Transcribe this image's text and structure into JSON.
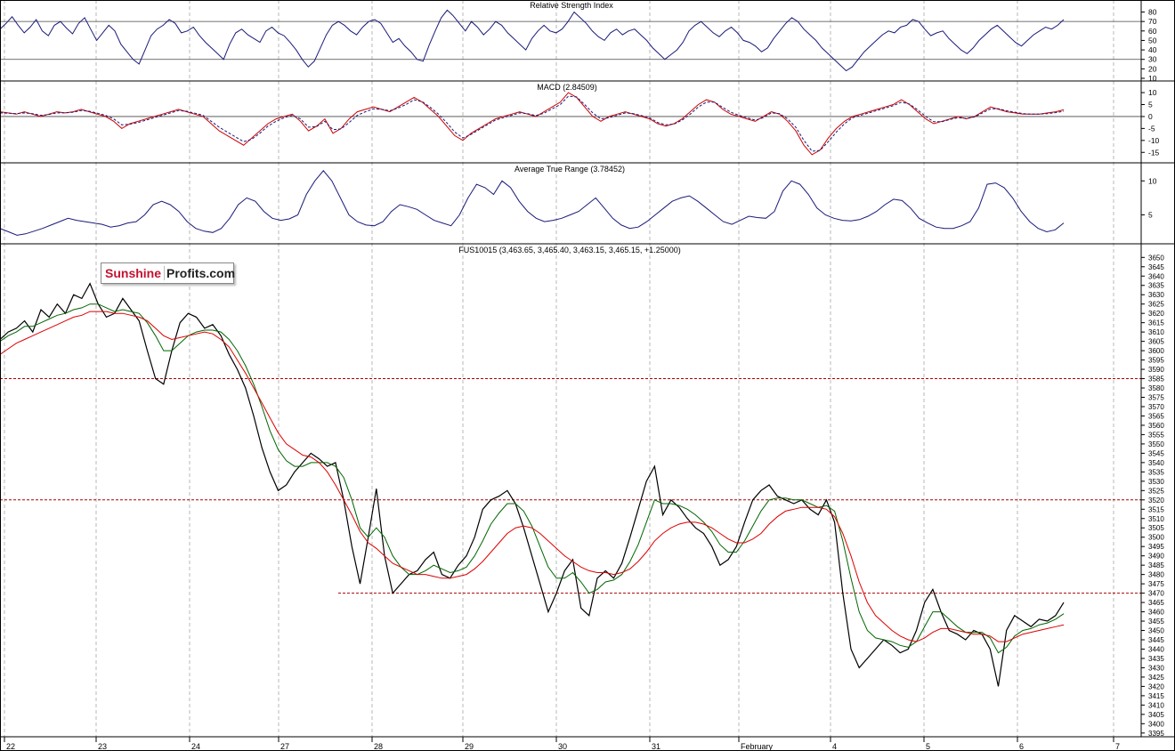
{
  "logo": {
    "part1": "Sunshine",
    "part2": "Profits.com"
  },
  "colors": {
    "rsi": "#1a1a7a",
    "macd": "#cc0000",
    "macd_signal": "#1a1a7a",
    "atr": "#1a1a7a",
    "price": "#000000",
    "ma_short": "#006600",
    "ma_long": "#dd0000",
    "support": "#aa0000",
    "grid": "#9a9a9a"
  },
  "chart_data": [
    {
      "type": "line",
      "title": "Relative Strength Index",
      "y_ticks": [
        10,
        20,
        30,
        40,
        50,
        60,
        70,
        80
      ],
      "ylim": [
        10,
        88
      ],
      "reference_lines": [
        30,
        70
      ],
      "series": [
        {
          "values": [
            62,
            68,
            75,
            66,
            58,
            64,
            72,
            60,
            55,
            66,
            70,
            63,
            57,
            68,
            74,
            62,
            50,
            58,
            66,
            60,
            46,
            38,
            30,
            25,
            40,
            55,
            62,
            66,
            72,
            68,
            58,
            60,
            64,
            55,
            48,
            42,
            36,
            30,
            46,
            58,
            62,
            56,
            52,
            48,
            60,
            64,
            58,
            55,
            48,
            40,
            30,
            22,
            28,
            42,
            56,
            66,
            70,
            66,
            60,
            56,
            64,
            70,
            72,
            68,
            58,
            48,
            52,
            44,
            38,
            30,
            28,
            45,
            60,
            74,
            82,
            76,
            68,
            60,
            70,
            64,
            56,
            62,
            70,
            66,
            58,
            52,
            46,
            40,
            52,
            60,
            66,
            60,
            58,
            62,
            70,
            80,
            74,
            68,
            60,
            54,
            50,
            58,
            62,
            56,
            60,
            62,
            56,
            50,
            42,
            36,
            30,
            35,
            40,
            48,
            60,
            66,
            70,
            64,
            58,
            54,
            60,
            64,
            58,
            50,
            48,
            44,
            38,
            42,
            52,
            60,
            68,
            74,
            70,
            62,
            56,
            50,
            42,
            36,
            30,
            24,
            18,
            22,
            30,
            38,
            44,
            50,
            56,
            60,
            58,
            64,
            66,
            72,
            70,
            62,
            55,
            58,
            60,
            52,
            46,
            40,
            36,
            42,
            50,
            56,
            62,
            66,
            60,
            54,
            48,
            44,
            50,
            56,
            60,
            64,
            62,
            66,
            72
          ]
        }
      ]
    },
    {
      "type": "line",
      "title": "MACD (2.84509)",
      "y_ticks": [
        10,
        5,
        0,
        -5,
        -10,
        -15
      ],
      "ylim": [
        -19,
        13
      ],
      "reference_lines": [
        0
      ],
      "series": [
        {
          "values": [
            2,
            1.5,
            1,
            2,
            1,
            0,
            1,
            2,
            1.5,
            2,
            3,
            2,
            1,
            0,
            -2,
            -5,
            -3,
            -2,
            -1,
            0,
            1,
            2,
            3,
            2,
            1,
            0,
            -3,
            -6,
            -8,
            -10,
            -12,
            -9,
            -6,
            -3,
            -1,
            0,
            1,
            -2,
            -6,
            -4,
            -1,
            -7,
            -5,
            -1,
            2,
            3,
            4,
            3,
            2,
            4,
            6,
            8,
            6,
            3,
            0,
            -4,
            -8,
            -10,
            -7,
            -5,
            -3,
            -1,
            0,
            1,
            2,
            1,
            0,
            2,
            4,
            6,
            10,
            8,
            4,
            0,
            -2,
            0,
            1,
            2,
            1,
            0,
            -1,
            -3,
            -4,
            -3,
            -1,
            2,
            5,
            7,
            6,
            3,
            1,
            0,
            -1,
            -2,
            0,
            2,
            1,
            -2,
            -6,
            -12,
            -16,
            -14,
            -9,
            -5,
            -2,
            0,
            1,
            2,
            3,
            4,
            5,
            7,
            5,
            2,
            -1,
            -3,
            -2,
            -1,
            0,
            -1,
            0,
            2,
            4,
            3,
            2,
            1.5,
            1,
            1,
            1,
            1.5,
            2,
            2.8
          ]
        },
        {
          "values": [
            1.5,
            1.4,
            1.2,
            1.5,
            1.2,
            0.5,
            0.8,
            1.5,
            1.5,
            1.8,
            2.5,
            2.2,
            1.4,
            0.5,
            -1,
            -3.5,
            -3.2,
            -2.5,
            -1.5,
            -0.5,
            0.5,
            1.5,
            2.5,
            2.2,
            1.4,
            0.5,
            -2,
            -4.5,
            -6.5,
            -8.5,
            -10.5,
            -9.5,
            -7,
            -4,
            -2,
            -0.5,
            0.5,
            -1,
            -4.5,
            -4.2,
            -2,
            -5.5,
            -5.2,
            -2.5,
            0.5,
            2,
            3.2,
            3,
            2.4,
            3.5,
            5,
            7,
            6.2,
            3.8,
            1,
            -2.5,
            -6.5,
            -9,
            -7.5,
            -5.5,
            -3.5,
            -1.5,
            -0.5,
            0.5,
            1.5,
            1.2,
            0.4,
            1.4,
            3.2,
            5,
            8.5,
            8.2,
            5,
            1.5,
            -1,
            -0.5,
            0.5,
            1.5,
            1.2,
            0.4,
            -0.5,
            -2.5,
            -3.5,
            -3.2,
            -1.5,
            1,
            4,
            6,
            6,
            3.8,
            1.8,
            0.5,
            -0.5,
            -1.5,
            -0.5,
            1.5,
            1.2,
            -1,
            -4.5,
            -10,
            -14.5,
            -14.2,
            -10.5,
            -6.5,
            -3,
            -0.5,
            0.5,
            1.5,
            2.5,
            3.5,
            4.5,
            6,
            5.2,
            2.8,
            0,
            -2.2,
            -2.2,
            -1.2,
            -0.5,
            -0.8,
            -0.2,
            1.5,
            3.2,
            3.2,
            2.4,
            1.8,
            1.2,
            1,
            1,
            1.2,
            1.6,
            2.2
          ]
        }
      ]
    },
    {
      "type": "line",
      "title": "Average True Range (3.78452)",
      "y_ticks": [
        5,
        10
      ],
      "ylim": [
        1,
        12
      ],
      "series": [
        {
          "values": [
            3,
            2.5,
            2,
            2.2,
            2.6,
            3,
            3.5,
            4,
            4.5,
            4.2,
            4,
            3.8,
            3.6,
            3.2,
            3.4,
            3.8,
            4,
            5,
            6.5,
            7,
            6.5,
            5.5,
            4,
            3,
            2.6,
            2.4,
            3,
            4.5,
            6.5,
            7.5,
            7,
            5.5,
            4.5,
            4.2,
            4.4,
            5,
            8,
            10,
            11.5,
            10,
            7.5,
            5,
            4,
            3.5,
            3.4,
            4,
            5.5,
            6.5,
            6.2,
            5.8,
            5,
            4.2,
            3.8,
            3.4,
            5,
            7.5,
            9.5,
            9,
            8,
            10,
            9,
            7,
            5.5,
            4.5,
            4,
            4.2,
            4.5,
            5,
            5.5,
            6.5,
            7.5,
            6,
            4.5,
            3.5,
            3,
            3.2,
            4,
            5,
            6,
            7,
            7.5,
            7.8,
            7,
            6,
            5,
            4,
            3.6,
            4.2,
            4.8,
            4.6,
            4.5,
            5.5,
            8.5,
            10,
            9.5,
            8,
            6,
            5,
            4.5,
            4.2,
            4.1,
            4.3,
            4.8,
            5.5,
            6.5,
            7.3,
            7.1,
            6,
            4.5,
            3.8,
            3.2,
            3,
            3,
            3.4,
            4,
            6,
            9.5,
            9.7,
            9,
            7.5,
            5.5,
            4,
            3,
            2.5,
            2.8,
            3.8
          ]
        }
      ]
    },
    {
      "type": "line",
      "title": "FUS10015 (3,463.65, 3,465.40, 3,463.15, 3,465.15, +1.25000)",
      "x_ticks": [
        "22",
        "23",
        "24",
        "27",
        "28",
        "29",
        "30",
        "31",
        "February",
        "4",
        "5",
        "6",
        "7"
      ],
      "y_ticks": [
        3395,
        3400,
        3405,
        3410,
        3415,
        3420,
        3425,
        3430,
        3435,
        3440,
        3445,
        3450,
        3455,
        3460,
        3465,
        3470,
        3475,
        3480,
        3485,
        3490,
        3495,
        3500,
        3505,
        3510,
        3515,
        3520,
        3525,
        3530,
        3535,
        3540,
        3545,
        3550,
        3555,
        3560,
        3565,
        3570,
        3575,
        3580,
        3585,
        3590,
        3595,
        3600,
        3605,
        3610,
        3615,
        3620,
        3625,
        3630,
        3635,
        3640,
        3645,
        3650
      ],
      "ylim": [
        3393,
        3653
      ],
      "reference_lines": [
        3585,
        3520,
        3470
      ],
      "series": [
        {
          "values": [
            3606,
            3610,
            3612,
            3616,
            3610,
            3622,
            3618,
            3625,
            3620,
            3630,
            3628,
            3636,
            3625,
            3618,
            3620,
            3628,
            3622,
            3616,
            3600,
            3585,
            3582,
            3600,
            3615,
            3620,
            3618,
            3612,
            3614,
            3608,
            3598,
            3590,
            3580,
            3565,
            3548,
            3535,
            3525,
            3528,
            3535,
            3540,
            3545,
            3542,
            3538,
            3540,
            3520,
            3495,
            3475,
            3500,
            3526,
            3490,
            3470,
            3475,
            3480,
            3482,
            3488,
            3492,
            3480,
            3478,
            3485,
            3490,
            3500,
            3515,
            3520,
            3522,
            3525,
            3518,
            3505,
            3490,
            3475,
            3460,
            3470,
            3482,
            3488,
            3462,
            3458,
            3478,
            3482,
            3478,
            3486,
            3500,
            3515,
            3530,
            3538,
            3512,
            3520,
            3516,
            3510,
            3505,
            3502,
            3495,
            3485,
            3488,
            3495,
            3508,
            3520,
            3525,
            3528,
            3522,
            3520,
            3518,
            3520,
            3515,
            3512,
            3520,
            3508,
            3470,
            3440,
            3430,
            3435,
            3440,
            3445,
            3442,
            3438,
            3440,
            3450,
            3465,
            3472,
            3460,
            3450,
            3448,
            3445,
            3450,
            3448,
            3440,
            3420,
            3450,
            3458,
            3455,
            3452,
            3456,
            3455,
            3458,
            3465
          ]
        },
        {
          "values": [
            3605,
            3608,
            3610,
            3613,
            3613,
            3615,
            3617,
            3619,
            3620,
            3622,
            3623,
            3625,
            3625,
            3623,
            3621,
            3622,
            3621,
            3620,
            3615,
            3608,
            3600,
            3600,
            3604,
            3608,
            3610,
            3611,
            3611,
            3610,
            3606,
            3600,
            3592,
            3582,
            3570,
            3557,
            3547,
            3541,
            3538,
            3538,
            3540,
            3540,
            3540,
            3538,
            3532,
            3520,
            3505,
            3500,
            3505,
            3500,
            3490,
            3484,
            3480,
            3480,
            3482,
            3485,
            3483,
            3481,
            3482,
            3484,
            3490,
            3498,
            3507,
            3513,
            3518,
            3518,
            3514,
            3506,
            3495,
            3484,
            3478,
            3478,
            3481,
            3476,
            3470,
            3472,
            3476,
            3477,
            3480,
            3487,
            3496,
            3508,
            3520,
            3518,
            3518,
            3517,
            3515,
            3512,
            3508,
            3503,
            3496,
            3492,
            3492,
            3498,
            3506,
            3514,
            3520,
            3521,
            3521,
            3520,
            3520,
            3518,
            3516,
            3517,
            3514,
            3498,
            3478,
            3460,
            3450,
            3446,
            3445,
            3444,
            3442,
            3441,
            3444,
            3452,
            3460,
            3460,
            3456,
            3452,
            3449,
            3449,
            3449,
            3446,
            3438,
            3441,
            3447,
            3450,
            3451,
            3453,
            3454,
            3456,
            3459
          ]
        },
        {
          "values": [
            3598,
            3601,
            3604,
            3606,
            3608,
            3610,
            3612,
            3614,
            3616,
            3618,
            3619,
            3621,
            3621,
            3621,
            3620,
            3620,
            3619,
            3618,
            3616,
            3612,
            3608,
            3606,
            3607,
            3608,
            3609,
            3610,
            3609,
            3606,
            3602,
            3595,
            3588,
            3580,
            3572,
            3564,
            3556,
            3550,
            3547,
            3544,
            3543,
            3540,
            3535,
            3528,
            3520,
            3512,
            3503,
            3497,
            3494,
            3490,
            3486,
            3484,
            3482,
            3480,
            3480,
            3479,
            3478,
            3478,
            3479,
            3480,
            3483,
            3487,
            3492,
            3497,
            3502,
            3505,
            3506,
            3505,
            3502,
            3498,
            3494,
            3490,
            3487,
            3484,
            3482,
            3481,
            3481,
            3480,
            3481,
            3483,
            3487,
            3492,
            3498,
            3502,
            3505,
            3507,
            3508,
            3508,
            3507,
            3505,
            3502,
            3499,
            3497,
            3497,
            3499,
            3502,
            3507,
            3511,
            3514,
            3515,
            3516,
            3516,
            3516,
            3515,
            3511,
            3502,
            3490,
            3476,
            3465,
            3458,
            3454,
            3450,
            3447,
            3445,
            3444,
            3446,
            3449,
            3451,
            3451,
            3450,
            3449,
            3448,
            3448,
            3447,
            3444,
            3444,
            3446,
            3448,
            3449,
            3450,
            3451,
            3452,
            3453
          ]
        }
      ]
    }
  ]
}
